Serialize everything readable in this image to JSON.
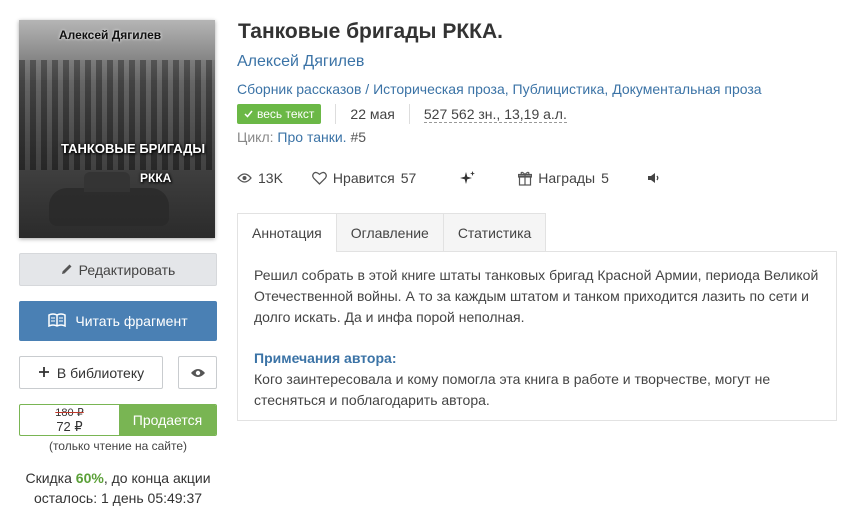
{
  "cover": {
    "author_text": "Алексей Дягилев",
    "title_line1": "ТАНКОВЫЕ БРИГАДЫ",
    "title_line2": "РККА"
  },
  "sidebar": {
    "edit_label": "Редактировать",
    "read_label": "Читать фрагмент",
    "library_label": "В библиотеку",
    "price_old": "180 ₽",
    "price_new": "72 ₽",
    "sell_label": "Продается",
    "read_note": "(только чтение на сайте)",
    "discount_prefix": "Скидка ",
    "discount_pct": "60%",
    "discount_suffix": ", до конца акции",
    "discount_time": "осталось: 1 день 05:49:37"
  },
  "book": {
    "title": "Танковые бригады РККА.",
    "author": "Алексей Дягилев",
    "genre_main": "Сборник рассказов",
    "genre_sep": " / ",
    "genres": [
      "Историческая проза",
      "Публицистика",
      "Документальная проза"
    ],
    "full_text_badge": "весь текст",
    "date": "22 мая",
    "size": "527 562 зн., 13,19 а.л.",
    "cycle_label": "Цикл:",
    "cycle_name": "Про танки.",
    "cycle_num": "#5"
  },
  "stats": {
    "views": "13K",
    "likes_label": "Нравится",
    "likes": "57",
    "awards_label": "Награды",
    "awards": "5"
  },
  "tabs": [
    "Аннотация",
    "Оглавление",
    "Статистика"
  ],
  "annotation": {
    "text": "Решил собрать в этой книге штаты танковых бригад Красной Армии, периода Великой Отечественной войны. А то за каждым штатом и танком приходится лазить по сети и долго искать. Да и инфа порой неполная.",
    "notes_title": "Примечания автора:",
    "notes_text": "Кого заинтересовала и кому помогла эта книга в работе и творчестве, могут не стесняться и поблагодарить автора."
  },
  "colors": {
    "link": "#3b73a6",
    "primary_button": "#4a80b4",
    "success": "#79b553"
  }
}
